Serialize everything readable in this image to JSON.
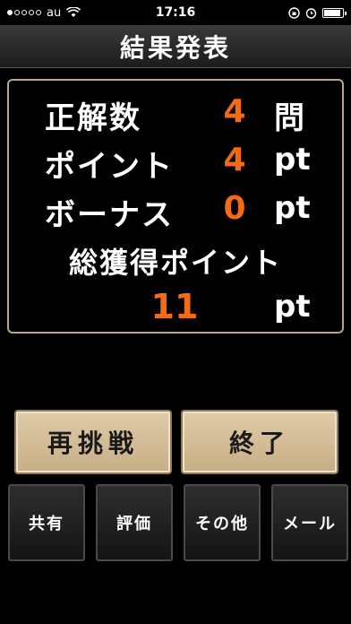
{
  "status_bar": {
    "carrier": "au",
    "time": "17:16"
  },
  "header": {
    "title": "結果発表"
  },
  "results": {
    "rows": [
      {
        "label": "正解数",
        "value": "4",
        "unit": "問"
      },
      {
        "label": "ポイント",
        "value": "4",
        "unit": "pt"
      },
      {
        "label": "ボーナス",
        "value": "0",
        "unit": "pt"
      }
    ],
    "total": {
      "label": "総獲得ポイント",
      "value": "11",
      "unit": "pt"
    }
  },
  "actions": {
    "retry_label": "再挑戦",
    "finish_label": "終了"
  },
  "footer_buttons": [
    {
      "label": "共有"
    },
    {
      "label": "評価"
    },
    {
      "label": "その他"
    },
    {
      "label": "メール"
    }
  ],
  "colors": {
    "accent_value": "#f36b12",
    "button_beige": "#d9c49e",
    "panel_border": "#b7a68a"
  }
}
